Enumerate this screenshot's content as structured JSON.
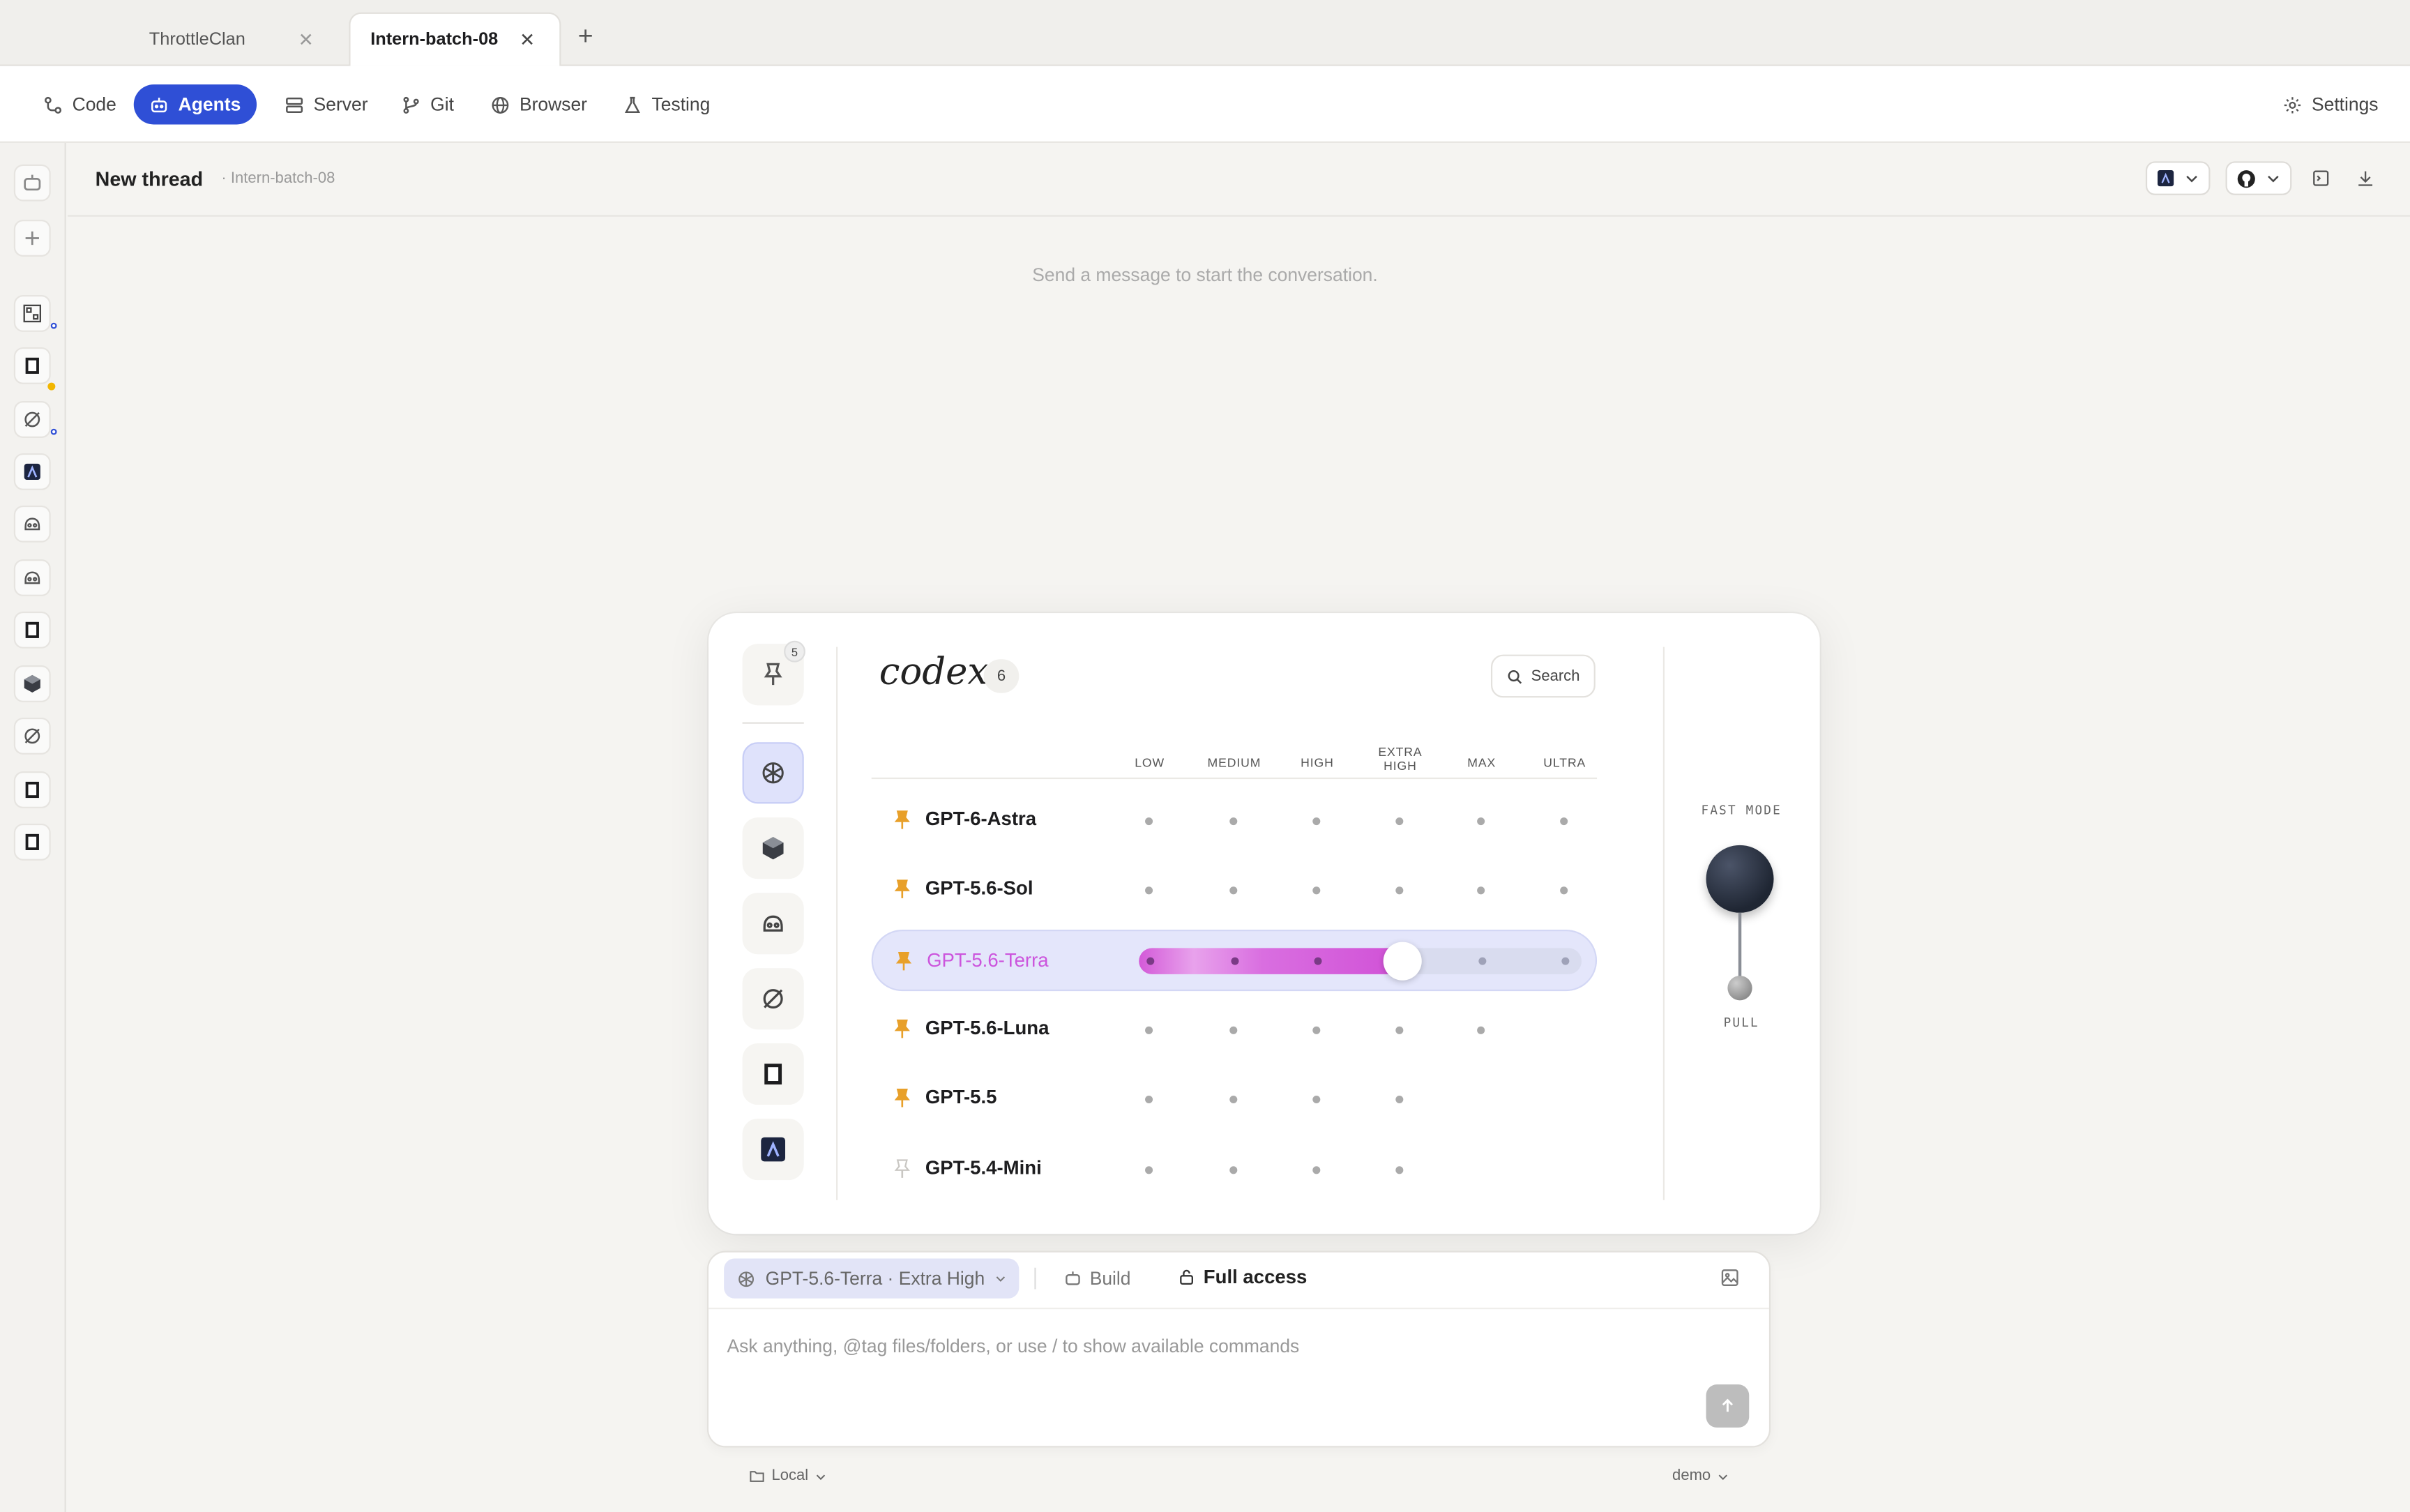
{
  "tabs": [
    {
      "label": "ThrottleClan",
      "active": false
    },
    {
      "label": "Intern-batch-08",
      "active": true
    }
  ],
  "nav": {
    "items": [
      "Code",
      "Agents",
      "Server",
      "Git",
      "Browser",
      "Testing"
    ],
    "active": "Agents",
    "settings": "Settings"
  },
  "thread": {
    "title": "New thread",
    "subtitle": "· Intern-batch-08",
    "empty_message": "Send a message to start the conversation."
  },
  "picker": {
    "logo": "codex",
    "pin_badge": "5",
    "count": "6",
    "search_label": "Search",
    "levels": [
      "LOW",
      "MEDIUM",
      "HIGH",
      "EXTRA HIGH",
      "MAX",
      "ULTRA"
    ],
    "models": [
      {
        "name": "GPT-6-Astra",
        "pinned": true,
        "levels_available": 6
      },
      {
        "name": "GPT-5.6-Sol",
        "pinned": true,
        "levels_available": 6
      },
      {
        "name": "GPT-5.6-Terra",
        "pinned": true,
        "levels_available": 6,
        "selected": true,
        "selected_level": "EXTRA HIGH"
      },
      {
        "name": "GPT-5.6-Luna",
        "pinned": true,
        "levels_available": 5
      },
      {
        "name": "GPT-5.5",
        "pinned": true,
        "levels_available": 4
      },
      {
        "name": "GPT-5.4-Mini",
        "pinned": false,
        "levels_available": 4
      }
    ],
    "fast_mode_label": "FAST MODE",
    "pull_label": "PULL"
  },
  "composer": {
    "model_chip": "GPT-5.6-Terra · Extra High",
    "build_label": "Build",
    "access_label": "Full access",
    "placeholder": "Ask anything, @tag files/folders, or use / to show available commands"
  },
  "footer": {
    "location": "Local",
    "user": "demo"
  },
  "colors": {
    "accent": "#2f4fd6",
    "selection": "#cc55dd",
    "pin": "#e8a02a"
  }
}
